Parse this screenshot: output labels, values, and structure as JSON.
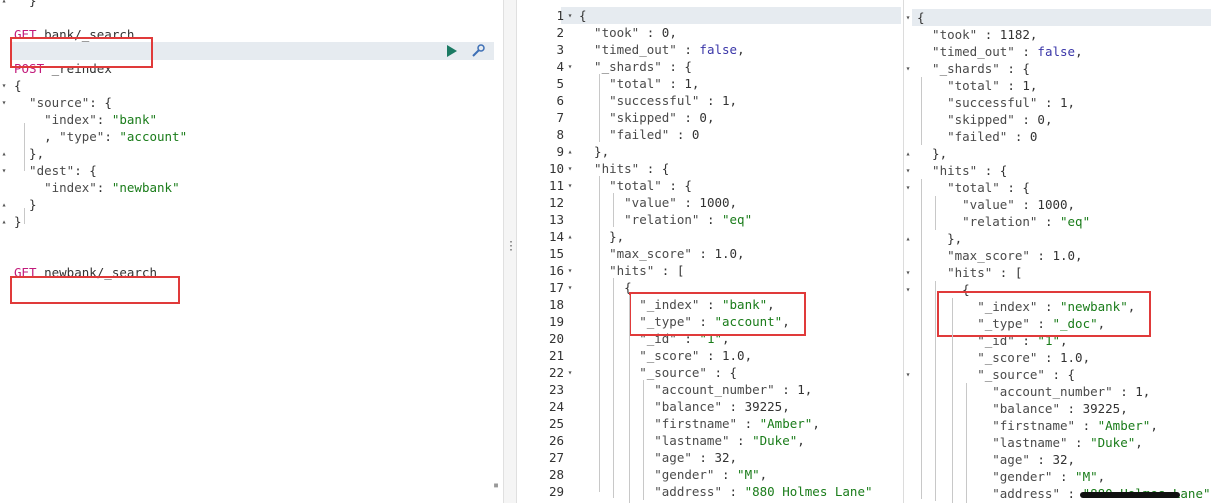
{
  "console": {
    "lines": [
      {
        "g": "▴",
        "t": [
          [
            "  }",
            "pun"
          ]
        ]
      },
      {
        "g": "",
        "t": []
      },
      {
        "g": "",
        "t": [
          [
            "GET",
            "meth"
          ],
          [
            " bank/_search",
            "pun"
          ]
        ]
      },
      {
        "g": "",
        "t": []
      },
      {
        "g": "",
        "t": [
          [
            "POST",
            "meth"
          ],
          [
            " _reindex",
            "pun"
          ]
        ]
      },
      {
        "g": "▾",
        "t": [
          [
            "{",
            "pun"
          ]
        ]
      },
      {
        "g": "▾",
        "t": [
          [
            "  \"source\"",
            "key"
          ],
          [
            ": {",
            "pun"
          ]
        ]
      },
      {
        "g": "",
        "t": [
          [
            "    \"index\"",
            "key"
          ],
          [
            ": ",
            "pun"
          ],
          [
            "\"bank\"",
            "str"
          ]
        ]
      },
      {
        "g": "",
        "t": [
          [
            "    , ",
            "pun"
          ],
          [
            "\"type\"",
            "key"
          ],
          [
            ": ",
            "pun"
          ],
          [
            "\"account\"",
            "str"
          ]
        ]
      },
      {
        "g": "▴",
        "t": [
          [
            "  },",
            "pun"
          ]
        ]
      },
      {
        "g": "▾",
        "t": [
          [
            "  \"dest\"",
            "key"
          ],
          [
            ": {",
            "pun"
          ]
        ]
      },
      {
        "g": "",
        "t": [
          [
            "    \"index\"",
            "key"
          ],
          [
            ": ",
            "pun"
          ],
          [
            "\"newbank\"",
            "str"
          ]
        ]
      },
      {
        "g": "▴",
        "t": [
          [
            "  }",
            "pun"
          ]
        ]
      },
      {
        "g": "▴",
        "t": [
          [
            "}",
            "pun"
          ]
        ]
      },
      {
        "g": "",
        "t": []
      },
      {
        "g": "",
        "t": []
      },
      {
        "g": "",
        "t": [
          [
            "GET",
            "meth"
          ],
          [
            " newbank/_search",
            "pun"
          ]
        ]
      }
    ]
  },
  "response1": {
    "lines": [
      {
        "n": "1",
        "g": "▾",
        "t": [
          [
            "{",
            "pun"
          ]
        ]
      },
      {
        "n": "2",
        "g": "",
        "t": [
          [
            "  \"took\"",
            "key"
          ],
          [
            " : 0,",
            "pun"
          ]
        ]
      },
      {
        "n": "3",
        "g": "",
        "t": [
          [
            "  \"timed_out\"",
            "key"
          ],
          [
            " : ",
            "pun"
          ],
          [
            "false",
            "lit"
          ],
          [
            ",",
            "pun"
          ]
        ]
      },
      {
        "n": "4",
        "g": "▾",
        "t": [
          [
            "  \"_shards\"",
            "key"
          ],
          [
            " : {",
            "pun"
          ]
        ]
      },
      {
        "n": "5",
        "g": "",
        "t": [
          [
            "    \"total\"",
            "key"
          ],
          [
            " : 1,",
            "pun"
          ]
        ]
      },
      {
        "n": "6",
        "g": "",
        "t": [
          [
            "    \"successful\"",
            "key"
          ],
          [
            " : 1,",
            "pun"
          ]
        ]
      },
      {
        "n": "7",
        "g": "",
        "t": [
          [
            "    \"skipped\"",
            "key"
          ],
          [
            " : 0,",
            "pun"
          ]
        ]
      },
      {
        "n": "8",
        "g": "",
        "t": [
          [
            "    \"failed\"",
            "key"
          ],
          [
            " : 0",
            "pun"
          ]
        ]
      },
      {
        "n": "9",
        "g": "▴",
        "t": [
          [
            "  },",
            "pun"
          ]
        ]
      },
      {
        "n": "10",
        "g": "▾",
        "t": [
          [
            "  \"hits\"",
            "key"
          ],
          [
            " : {",
            "pun"
          ]
        ]
      },
      {
        "n": "11",
        "g": "▾",
        "t": [
          [
            "    \"total\"",
            "key"
          ],
          [
            " : {",
            "pun"
          ]
        ]
      },
      {
        "n": "12",
        "g": "",
        "t": [
          [
            "      \"value\"",
            "key"
          ],
          [
            " : 1000,",
            "pun"
          ]
        ]
      },
      {
        "n": "13",
        "g": "",
        "t": [
          [
            "      \"relation\"",
            "key"
          ],
          [
            " : ",
            "pun"
          ],
          [
            "\"eq\"",
            "str"
          ]
        ]
      },
      {
        "n": "14",
        "g": "▴",
        "t": [
          [
            "    },",
            "pun"
          ]
        ]
      },
      {
        "n": "15",
        "g": "",
        "t": [
          [
            "    \"max_score\"",
            "key"
          ],
          [
            " : 1.0,",
            "pun"
          ]
        ]
      },
      {
        "n": "16",
        "g": "▾",
        "t": [
          [
            "    \"hits\"",
            "key"
          ],
          [
            " : [",
            "pun"
          ]
        ]
      },
      {
        "n": "17",
        "g": "▾",
        "t": [
          [
            "      {",
            "pun"
          ]
        ]
      },
      {
        "n": "18",
        "g": "",
        "t": [
          [
            "        \"_index\"",
            "key"
          ],
          [
            " : ",
            "pun"
          ],
          [
            "\"bank\"",
            "str"
          ],
          [
            ",",
            "pun"
          ]
        ]
      },
      {
        "n": "19",
        "g": "",
        "t": [
          [
            "        \"_type\"",
            "key"
          ],
          [
            " : ",
            "pun"
          ],
          [
            "\"account\"",
            "str"
          ],
          [
            ",",
            "pun"
          ]
        ]
      },
      {
        "n": "20",
        "g": "",
        "t": [
          [
            "        \"_id\"",
            "key"
          ],
          [
            " : ",
            "pun"
          ],
          [
            "\"1\"",
            "str"
          ],
          [
            ",",
            "pun"
          ]
        ]
      },
      {
        "n": "21",
        "g": "",
        "t": [
          [
            "        \"_score\"",
            "key"
          ],
          [
            " : 1.0,",
            "pun"
          ]
        ]
      },
      {
        "n": "22",
        "g": "▾",
        "t": [
          [
            "        \"_source\"",
            "key"
          ],
          [
            " : {",
            "pun"
          ]
        ]
      },
      {
        "n": "23",
        "g": "",
        "t": [
          [
            "          \"account_number\"",
            "key"
          ],
          [
            " : 1,",
            "pun"
          ]
        ]
      },
      {
        "n": "24",
        "g": "",
        "t": [
          [
            "          \"balance\"",
            "key"
          ],
          [
            " : 39225,",
            "pun"
          ]
        ]
      },
      {
        "n": "25",
        "g": "",
        "t": [
          [
            "          \"firstname\"",
            "key"
          ],
          [
            " : ",
            "pun"
          ],
          [
            "\"Amber\"",
            "str"
          ],
          [
            ",",
            "pun"
          ]
        ]
      },
      {
        "n": "26",
        "g": "",
        "t": [
          [
            "          \"lastname\"",
            "key"
          ],
          [
            " : ",
            "pun"
          ],
          [
            "\"Duke\"",
            "str"
          ],
          [
            ",",
            "pun"
          ]
        ]
      },
      {
        "n": "27",
        "g": "",
        "t": [
          [
            "          \"age\"",
            "key"
          ],
          [
            " : 32,",
            "pun"
          ]
        ]
      },
      {
        "n": "28",
        "g": "",
        "t": [
          [
            "          \"gender\"",
            "key"
          ],
          [
            " : ",
            "pun"
          ],
          [
            "\"M\"",
            "str"
          ],
          [
            ",",
            "pun"
          ]
        ]
      },
      {
        "n": "29",
        "g": "",
        "t": [
          [
            "          \"address\"",
            "key"
          ],
          [
            " : ",
            "pun"
          ],
          [
            "\"880 Holmes Lane\"",
            "str"
          ]
        ]
      }
    ]
  },
  "response2": {
    "lines": [
      {
        "g": "▾",
        "t": [
          [
            "{",
            "pun"
          ]
        ]
      },
      {
        "g": "",
        "t": [
          [
            "  \"took\"",
            "key"
          ],
          [
            " : 1182,",
            "pun"
          ]
        ]
      },
      {
        "g": "",
        "t": [
          [
            "  \"timed_out\"",
            "key"
          ],
          [
            " : ",
            "pun"
          ],
          [
            "false",
            "lit"
          ],
          [
            ",",
            "pun"
          ]
        ]
      },
      {
        "g": "▾",
        "t": [
          [
            "  \"_shards\"",
            "key"
          ],
          [
            " : {",
            "pun"
          ]
        ]
      },
      {
        "g": "",
        "t": [
          [
            "    \"total\"",
            "key"
          ],
          [
            " : 1,",
            "pun"
          ]
        ]
      },
      {
        "g": "",
        "t": [
          [
            "    \"successful\"",
            "key"
          ],
          [
            " : 1,",
            "pun"
          ]
        ]
      },
      {
        "g": "",
        "t": [
          [
            "    \"skipped\"",
            "key"
          ],
          [
            " : 0,",
            "pun"
          ]
        ]
      },
      {
        "g": "",
        "t": [
          [
            "    \"failed\"",
            "key"
          ],
          [
            " : 0",
            "pun"
          ]
        ]
      },
      {
        "g": "▴",
        "t": [
          [
            "  },",
            "pun"
          ]
        ]
      },
      {
        "g": "▾",
        "t": [
          [
            "  \"hits\"",
            "key"
          ],
          [
            " : {",
            "pun"
          ]
        ]
      },
      {
        "g": "▾",
        "t": [
          [
            "    \"total\"",
            "key"
          ],
          [
            " : {",
            "pun"
          ]
        ]
      },
      {
        "g": "",
        "t": [
          [
            "      \"value\"",
            "key"
          ],
          [
            " : 1000,",
            "pun"
          ]
        ]
      },
      {
        "g": "",
        "t": [
          [
            "      \"relation\"",
            "key"
          ],
          [
            " : ",
            "pun"
          ],
          [
            "\"eq\"",
            "str"
          ]
        ]
      },
      {
        "g": "▴",
        "t": [
          [
            "    },",
            "pun"
          ]
        ]
      },
      {
        "g": "",
        "t": [
          [
            "    \"max_score\"",
            "key"
          ],
          [
            " : 1.0,",
            "pun"
          ]
        ]
      },
      {
        "g": "▾",
        "t": [
          [
            "    \"hits\"",
            "key"
          ],
          [
            " : [",
            "pun"
          ]
        ]
      },
      {
        "g": "▾",
        "t": [
          [
            "      {",
            "pun"
          ]
        ]
      },
      {
        "g": "",
        "t": [
          [
            "        \"_index\"",
            "key"
          ],
          [
            " : ",
            "pun"
          ],
          [
            "\"newbank\"",
            "str"
          ],
          [
            ",",
            "pun"
          ]
        ]
      },
      {
        "g": "",
        "t": [
          [
            "        \"_type\"",
            "key"
          ],
          [
            " : ",
            "pun"
          ],
          [
            "\"_doc\"",
            "str"
          ],
          [
            ",",
            "pun"
          ]
        ]
      },
      {
        "g": "",
        "t": [
          [
            "        \"_id\"",
            "key"
          ],
          [
            " : ",
            "pun"
          ],
          [
            "\"1\"",
            "str"
          ],
          [
            ",",
            "pun"
          ]
        ]
      },
      {
        "g": "",
        "t": [
          [
            "        \"_score\"",
            "key"
          ],
          [
            " : 1.0,",
            "pun"
          ]
        ]
      },
      {
        "g": "▾",
        "t": [
          [
            "        \"_source\"",
            "key"
          ],
          [
            " : {",
            "pun"
          ]
        ]
      },
      {
        "g": "",
        "t": [
          [
            "          \"account_number\"",
            "key"
          ],
          [
            " : 1,",
            "pun"
          ]
        ]
      },
      {
        "g": "",
        "t": [
          [
            "          \"balance\"",
            "key"
          ],
          [
            " : 39225,",
            "pun"
          ]
        ]
      },
      {
        "g": "",
        "t": [
          [
            "          \"firstname\"",
            "key"
          ],
          [
            " : ",
            "pun"
          ],
          [
            "\"Amber\"",
            "str"
          ],
          [
            ",",
            "pun"
          ]
        ]
      },
      {
        "g": "",
        "t": [
          [
            "          \"lastname\"",
            "key"
          ],
          [
            " : ",
            "pun"
          ],
          [
            "\"Duke\"",
            "str"
          ],
          [
            ",",
            "pun"
          ]
        ]
      },
      {
        "g": "",
        "t": [
          [
            "          \"age\"",
            "key"
          ],
          [
            " : 32,",
            "pun"
          ]
        ]
      },
      {
        "g": "",
        "t": [
          [
            "          \"gender\"",
            "key"
          ],
          [
            " : ",
            "pun"
          ],
          [
            "\"M\"",
            "str"
          ],
          [
            ",",
            "pun"
          ]
        ]
      },
      {
        "g": "",
        "t": [
          [
            "          \"address\"",
            "key"
          ],
          [
            " : ",
            "pun"
          ],
          [
            "\"880 Holmes Lane\"",
            "str"
          ]
        ]
      }
    ]
  },
  "icons": {
    "play": "play-icon",
    "wrench": "wrench-icon",
    "divider_grip": "vertical-dots-icon",
    "resize_grip": "resize-grip-icon"
  },
  "colors": {
    "highlight_box": "#e03a3a",
    "method": "#c21b7b",
    "string": "#1a7c1a",
    "literal": "#3a36a8",
    "active_line": "#e6ebf0",
    "play": "#1b7a63"
  }
}
